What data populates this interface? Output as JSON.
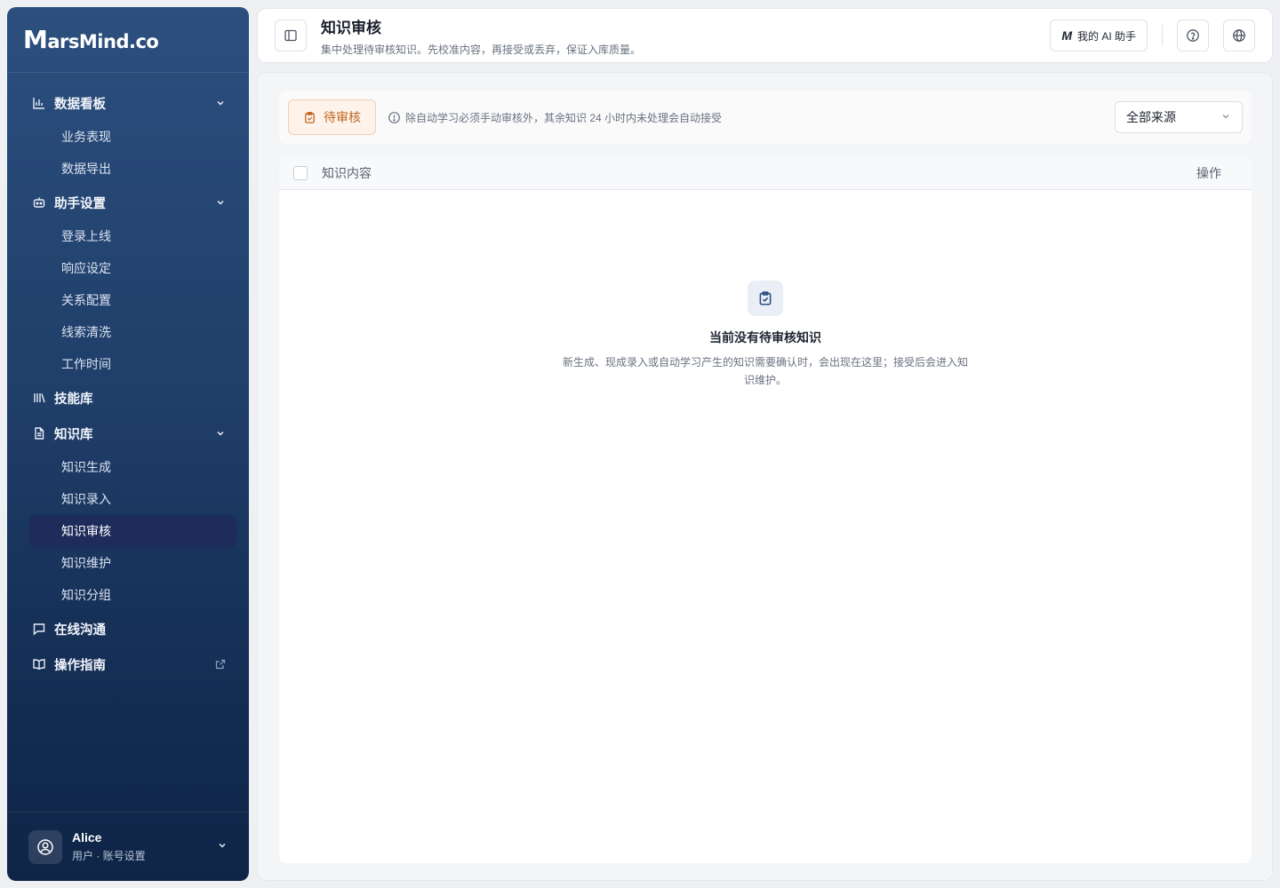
{
  "brand": {
    "name_big": "M",
    "name_rest": "arsMind.co"
  },
  "sidebar": {
    "groups": [
      {
        "label": "数据看板",
        "icon": "bar-chart-icon",
        "expanded": true,
        "items": [
          "业务表现",
          "数据导出"
        ]
      },
      {
        "label": "助手设置",
        "icon": "robot-icon",
        "expanded": true,
        "items": [
          "登录上线",
          "响应设定",
          "关系配置",
          "线索清洗",
          "工作时间"
        ]
      },
      {
        "label": "技能库",
        "icon": "library-icon",
        "expanded": false,
        "items": []
      },
      {
        "label": "知识库",
        "icon": "document-icon",
        "expanded": true,
        "items": [
          "知识生成",
          "知识录入",
          "知识审核",
          "知识维护",
          "知识分组"
        ]
      },
      {
        "label": "在线沟通",
        "icon": "chat-bubble-icon",
        "expanded": false,
        "items": []
      },
      {
        "label": "操作指南",
        "icon": "book-open-icon",
        "expanded": false,
        "items": [],
        "external": true
      }
    ],
    "active_item": "知识审核"
  },
  "user": {
    "name": "Alice",
    "subtitle": "用户 · 账号设置"
  },
  "header": {
    "title": "知识审核",
    "subtitle": "集中处理待审核知识。先校准内容，再接受或丢弃，保证入库质量。",
    "ai_button": "我的 AI 助手",
    "ai_logo": "M"
  },
  "toolbar": {
    "pending_tab": "待审核",
    "notice": "除自动学习必须手动审核外，其余知识 24 小时内未处理会自动接受",
    "source_select": "全部来源"
  },
  "table": {
    "columns": [
      "知识内容",
      "操作"
    ]
  },
  "empty_state": {
    "title": "当前没有待审核知识",
    "description": "新生成、现成录入或自动学习产生的知识需要确认时，会出现在这里；接受后会进入知识维护。"
  },
  "colors": {
    "sidebar_top": "#2c4f7e",
    "sidebar_bottom": "#0f2547",
    "active_item_bg": "#1d2c5b",
    "pending_accent": "#c2661f"
  }
}
